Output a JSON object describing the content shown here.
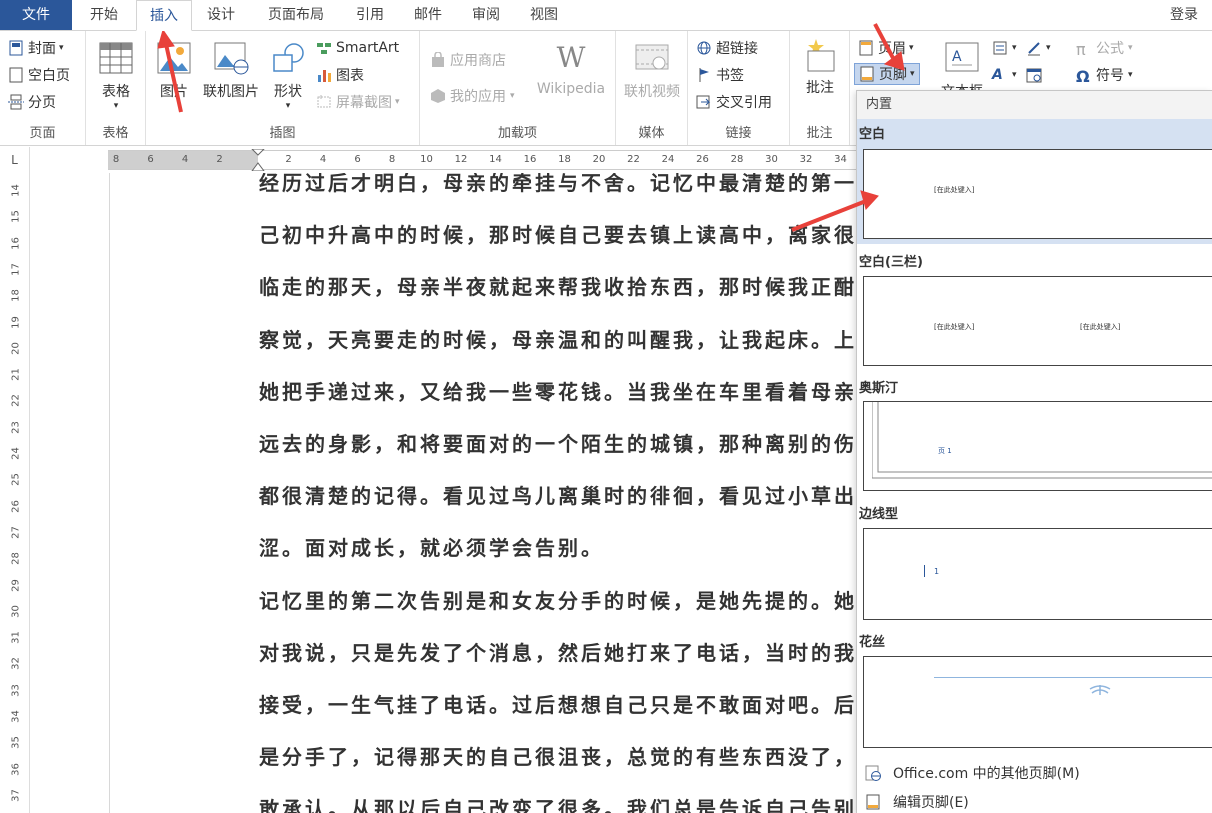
{
  "tabs": {
    "file": "文件",
    "home": "开始",
    "insert": "插入",
    "design": "设计",
    "layout": "页面布局",
    "references": "引用",
    "mailings": "邮件",
    "review": "审阅",
    "view": "视图",
    "login": "登录"
  },
  "ribbon": {
    "pages": {
      "cover": "封面",
      "blank": "空白页",
      "break": "分页",
      "label": "页面"
    },
    "tables": {
      "table": "表格",
      "label": "表格"
    },
    "illustrations": {
      "picture": "图片",
      "online_picture": "联机图片",
      "shapes": "形状",
      "smartart": "SmartArt",
      "chart": "图表",
      "screenshot": "屏幕截图",
      "label": "插图"
    },
    "addins": {
      "store": "应用商店",
      "my_apps": "我的应用",
      "wikipedia": "Wikipedia",
      "label": "加载项"
    },
    "media": {
      "online_video": "联机视频",
      "label": "媒体"
    },
    "links": {
      "hyperlink": "超链接",
      "bookmark": "书签",
      "cross_ref": "交叉引用",
      "label": "链接"
    },
    "comments": {
      "comment": "批注",
      "label": "批注"
    },
    "header_footer": {
      "header": "页眉",
      "footer": "页脚"
    },
    "text": {
      "textbox": "文本框"
    },
    "symbols": {
      "equation": "公式",
      "symbol": "符号"
    }
  },
  "ruler": {
    "corner": "L",
    "h_ticks": [
      "8",
      "6",
      "4",
      "2",
      "",
      "2",
      "4",
      "6",
      "8",
      "10",
      "12",
      "14",
      "16",
      "18",
      "20",
      "22",
      "24",
      "26",
      "28",
      "30",
      "32",
      "34"
    ],
    "v_ticks": [
      "14",
      "15",
      "16",
      "17",
      "18",
      "19",
      "20",
      "21",
      "22",
      "23",
      "24",
      "25",
      "26",
      "27",
      "28",
      "29",
      "30",
      "31",
      "32",
      "33",
      "34",
      "35",
      "36",
      "37"
    ]
  },
  "document": {
    "lines": [
      "经历过后才明白，母亲的牵挂与不舍。记忆中最清楚的第一次告",
      "己初中升高中的时候，那时候自己要去镇上读高中，离家很",
      "临走的那天，母亲半夜就起来帮我收拾东西，那时候我正酣",
      "察觉，天亮要走的时候，母亲温和的叫醒我，让我起床。上车",
      "她把手递过来，又给我一些零花钱。当我坐在车里看着母亲",
      "远去的身影，和将要面对的一个陌生的城镇，那种离别的伤",
      "都很清楚的记得。看见过鸟儿离巢时的徘徊，看见过小草出",
      "涩。面对成长，就必须学会告别。",
      "记忆里的第二次告别是和女友分手的时候，是她先提的。她",
      "对我说，只是先发了个消息，然后她打来了电话，当时的我",
      "接受，一生气挂了电话。过后想想自己只是不敢面对吧。后",
      "是分手了，记得那天的自己很沮丧，总觉的有些东西没了，",
      "敢承认。从那以后自己改变了很多。我们总是告诉自己告别才"
    ]
  },
  "footer_gallery": {
    "header": "内置",
    "items": [
      {
        "title": "空白",
        "placeholder": "[在此处键入]"
      },
      {
        "title": "空白(三栏)",
        "placeholder_left": "[在此处键入]",
        "placeholder_right": "[在此处键入]"
      },
      {
        "title": "奥斯汀",
        "page_text": "页 1"
      },
      {
        "title": "边线型",
        "page_number": "1"
      },
      {
        "title": "花丝"
      }
    ],
    "more_footers": "Office.com 中的其他页脚(M)",
    "edit_footer": "编辑页脚(E)"
  },
  "colors": {
    "accent": "#2b579a",
    "selection": "#d5e1f2",
    "arrow": "#e8413a"
  }
}
